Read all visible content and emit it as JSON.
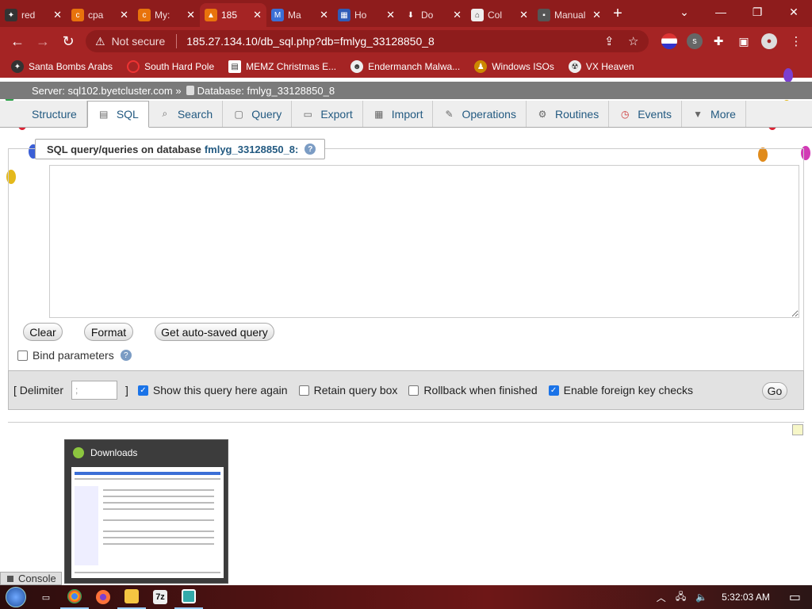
{
  "browser": {
    "tabs": [
      {
        "title": "red",
        "active": false
      },
      {
        "title": "cpa",
        "active": false
      },
      {
        "title": "My:",
        "active": false
      },
      {
        "title": "185",
        "active": true
      },
      {
        "title": "Ma",
        "active": false
      },
      {
        "title": "Ho",
        "active": false
      },
      {
        "title": "Do",
        "active": false
      },
      {
        "title": "Col",
        "active": false
      },
      {
        "title": "Manual",
        "active": false
      }
    ],
    "security_label": "Not secure",
    "url": "185.27.134.10/db_sql.php?db=fmlyg_33128850_8",
    "profile_letter": "s",
    "bookmarks": [
      {
        "label": "Santa Bombs Arabs"
      },
      {
        "label": "South Hard Pole"
      },
      {
        "label": "MEMZ Christmas E..."
      },
      {
        "label": "Endermanch Malwa..."
      },
      {
        "label": "Windows ISOs"
      },
      {
        "label": "VX Heaven"
      }
    ]
  },
  "pma": {
    "breadcrumb": {
      "server": "Server: sql102.byetcluster.com »",
      "database": "Database: fmlyg_33128850_8"
    },
    "tabs": [
      {
        "label": "Structure",
        "icon": "structure-icon",
        "active": false
      },
      {
        "label": "SQL",
        "icon": "sql-icon",
        "active": true
      },
      {
        "label": "Search",
        "icon": "search-icon",
        "active": false
      },
      {
        "label": "Query",
        "icon": "query-icon",
        "active": false
      },
      {
        "label": "Export",
        "icon": "export-icon",
        "active": false
      },
      {
        "label": "Import",
        "icon": "import-icon",
        "active": false
      },
      {
        "label": "Operations",
        "icon": "wrench-icon",
        "active": false
      },
      {
        "label": "Routines",
        "icon": "routines-icon",
        "active": false
      },
      {
        "label": "Events",
        "icon": "clock-icon",
        "active": false
      },
      {
        "label": "More",
        "icon": "caret-down-icon",
        "active": false
      }
    ],
    "legend": {
      "prefix": "SQL query/queries on database",
      "db": "fmlyg_33128850_8:"
    },
    "sql_value": "",
    "buttons": {
      "clear": "Clear",
      "format": "Format",
      "autosaved": "Get auto-saved query"
    },
    "bind_params": "Bind parameters",
    "options": {
      "delimiter_prefix": "[ Delimiter",
      "delimiter_value": ";",
      "delimiter_suffix": "]",
      "show_query": "Show this query here again",
      "retain_box": "Retain query box",
      "rollback": "Rollback when finished",
      "fk_checks": "Enable foreign key checks",
      "go": "Go"
    },
    "console": "Console"
  },
  "preview": {
    "title": "Downloads"
  },
  "taskbar": {
    "time": "5:32:03 AM"
  },
  "colors": {
    "chrome_frame": "#8e1c1c",
    "toolbar": "#a52424",
    "link": "#235a81",
    "checkbox_on": "#1a73e8"
  }
}
